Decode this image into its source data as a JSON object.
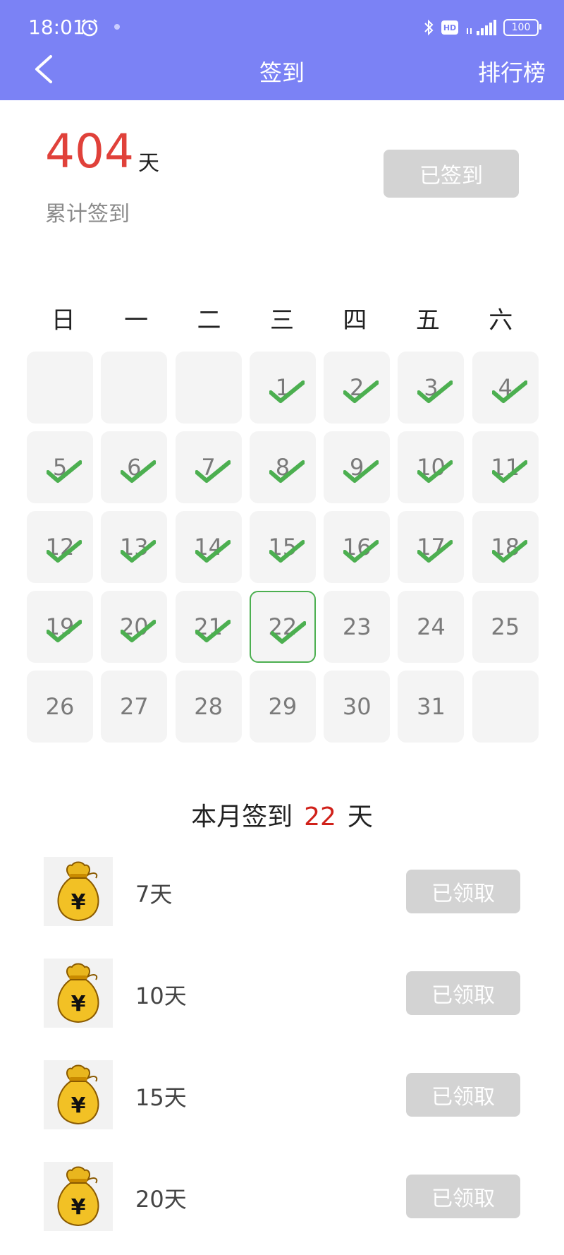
{
  "status": {
    "time": "18:01",
    "battery": "100",
    "network": "5G"
  },
  "header": {
    "title": "签到",
    "rank_link": "排行榜"
  },
  "summary": {
    "total_days": "404",
    "unit": "天",
    "label": "累计签到",
    "button_label": "已签到"
  },
  "calendar": {
    "weekdays": [
      "日",
      "一",
      "二",
      "三",
      "四",
      "五",
      "六"
    ],
    "first_weekday_index": 3,
    "days_in_month": 31,
    "checked_days": [
      1,
      2,
      3,
      4,
      5,
      6,
      7,
      8,
      9,
      10,
      11,
      12,
      13,
      14,
      15,
      16,
      17,
      18,
      19,
      20,
      21,
      22
    ],
    "today": 22,
    "check_color": "#4CAF50"
  },
  "monthly": {
    "prefix": "本月签到",
    "count": "22",
    "suffix": "天"
  },
  "rewards": [
    {
      "label": "7天",
      "button": "已领取",
      "icon": "money-bag-icon"
    },
    {
      "label": "10天",
      "button": "已领取",
      "icon": "money-bag-icon"
    },
    {
      "label": "15天",
      "button": "已领取",
      "icon": "money-bag-icon"
    },
    {
      "label": "20天",
      "button": "已领取",
      "icon": "money-bag-icon"
    }
  ],
  "colors": {
    "header": "#7B82F5",
    "accent_red": "#E0413A",
    "button_gray": "#D3D3D3",
    "today_border": "#4CAF50"
  }
}
